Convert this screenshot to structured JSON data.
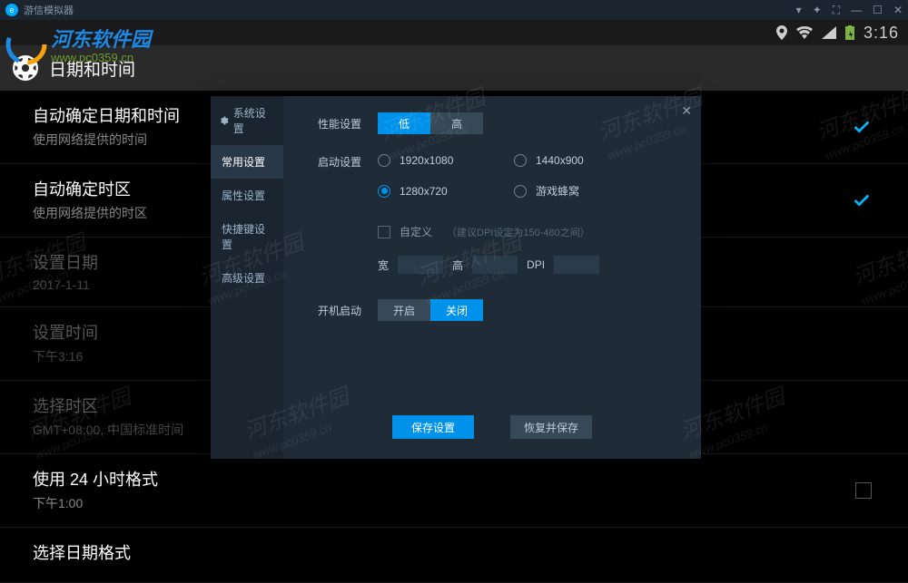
{
  "titlebar": {
    "title": "游信模拟器"
  },
  "statusbar": {
    "time": "3:16"
  },
  "page": {
    "title": "日期和时间"
  },
  "settings": [
    {
      "title": "自动确定日期和时间",
      "sub": "使用网络提供的时间",
      "checked": true
    },
    {
      "title": "自动确定时区",
      "sub": "使用网络提供的时区",
      "checked": true
    },
    {
      "title": "设置日期",
      "sub": "2017-1-11",
      "dim": true
    },
    {
      "title": "设置时间",
      "sub": "下午3:16",
      "dim": true
    },
    {
      "title": "选择时区",
      "sub": "GMT+08:00, 中国标准时间",
      "dim": true
    },
    {
      "title": "使用 24 小时格式",
      "sub": "下午1:00",
      "checkbox": true
    },
    {
      "title": "选择日期格式",
      "sub": ""
    }
  ],
  "modal": {
    "header": "系统设置",
    "tabs": [
      "常用设置",
      "属性设置",
      "快捷键设置",
      "高级设置"
    ],
    "performance": {
      "label": "性能设置",
      "low": "低",
      "high": "高"
    },
    "startup": {
      "label": "启动设置",
      "options": [
        "1920x1080",
        "1440x900",
        "1280x720",
        "游戏蜂窝"
      ],
      "custom": "自定义",
      "hint": "（建议DPI设定为150-480之间）",
      "width_label": "宽",
      "height_label": "高",
      "dpi_label": "DPI"
    },
    "autostart": {
      "label": "开机启动",
      "on": "开启",
      "off": "关闭"
    },
    "footer": {
      "save": "保存设置",
      "restore": "恢复并保存"
    }
  },
  "watermark": {
    "text": "河东软件园",
    "url": "www.pc0359.cn"
  }
}
